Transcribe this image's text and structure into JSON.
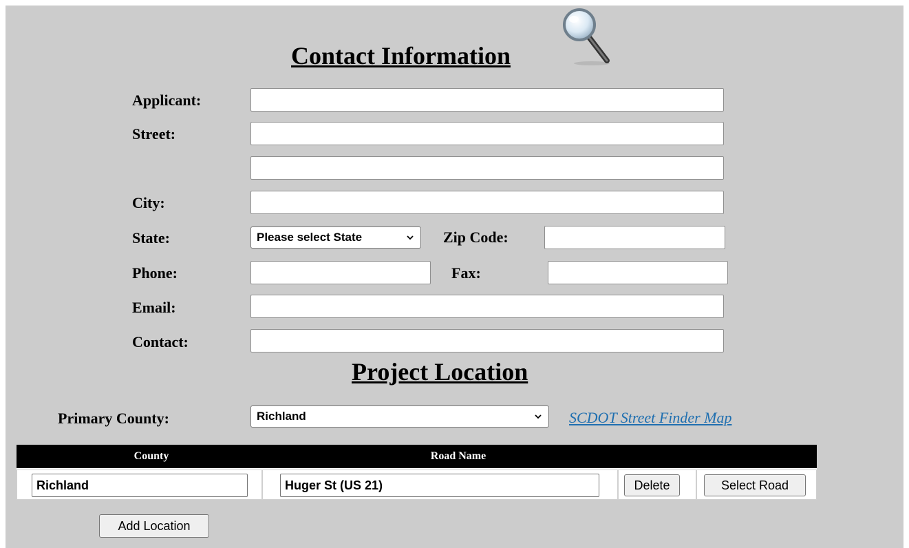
{
  "contact": {
    "heading": "Contact Information",
    "icon": "magnifier-icon",
    "fields": {
      "applicant_label": "Applicant:",
      "applicant_value": "",
      "street_label": "Street:",
      "street1_value": "",
      "street2_value": "",
      "city_label": "City:",
      "city_value": "",
      "state_label": "State:",
      "state_selected": "Please select State",
      "zip_label": "Zip Code:",
      "zip_value": "",
      "phone_label": "Phone:",
      "phone_value": "",
      "fax_label": "Fax:",
      "fax_value": "",
      "email_label": "Email:",
      "email_value": "",
      "contact_label": "Contact:",
      "contact_value": ""
    }
  },
  "project": {
    "heading": "Project Location",
    "primary_county_label": "Primary County:",
    "primary_county_selected": "Richland",
    "map_link": "SCDOT Street Finder Map",
    "table": {
      "headers": {
        "county": "County",
        "road_name": "Road Name"
      },
      "rows": [
        {
          "county": "Richland",
          "road_name": "Huger St (US 21)",
          "delete_label": "Delete",
          "select_road_label": "Select Road"
        }
      ]
    },
    "add_location_label": "Add Location"
  },
  "colors": {
    "panel_bg": "#cccccc",
    "table_header_bg": "#000000",
    "link": "#1f6fb0"
  }
}
